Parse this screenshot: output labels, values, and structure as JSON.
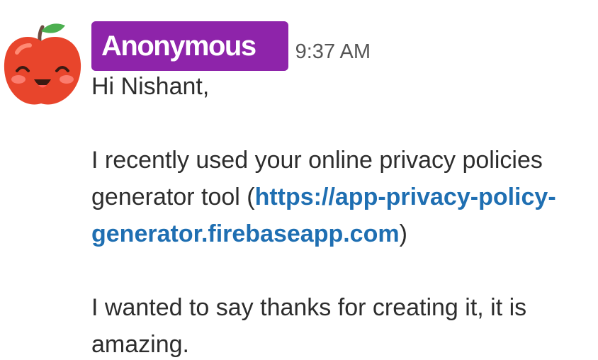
{
  "message": {
    "author": "Anonymous",
    "time": "9:37 AM",
    "avatar_icon": "apple-face-icon",
    "colors": {
      "badge": "#8e24aa",
      "link": "#1f6fb2"
    },
    "greeting": "Hi Nishant,",
    "para2_line1": "I recently used your online privacy policies",
    "para2_line2_prefix": "generator tool (",
    "link_part1": "https://app-privacy-policy-",
    "link_part2": "generator.firebaseapp.com",
    "para2_suffix": ")",
    "para3_line1": "I wanted to say thanks for creating it, it is",
    "para3_line2": "amazing."
  }
}
